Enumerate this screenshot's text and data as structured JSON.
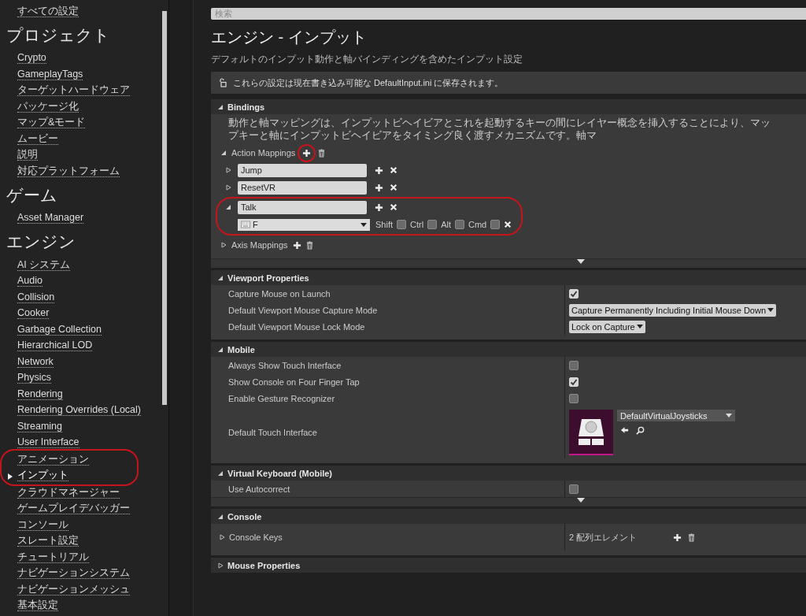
{
  "sidebar": {
    "all_settings": "すべての設定",
    "groups": [
      {
        "title": "プロジェクト",
        "items": [
          {
            "label": "Crypto",
            "selected": false
          },
          {
            "label": "GameplayTags",
            "selected": false
          },
          {
            "label": "ターゲットハードウェア",
            "selected": false
          },
          {
            "label": "パッケージ化",
            "selected": false
          },
          {
            "label": "マップ&モード",
            "selected": false
          },
          {
            "label": "ムービー",
            "selected": false
          },
          {
            "label": "説明",
            "selected": false
          },
          {
            "label": "対応プラットフォーム",
            "selected": false
          }
        ]
      },
      {
        "title": "ゲーム",
        "items": [
          {
            "label": "Asset Manager",
            "selected": false
          }
        ]
      },
      {
        "title": "エンジン",
        "items": [
          {
            "label": "AI システム",
            "selected": false
          },
          {
            "label": "Audio",
            "selected": false
          },
          {
            "label": "Collision",
            "selected": false
          },
          {
            "label": "Cooker",
            "selected": false
          },
          {
            "label": "Garbage Collection",
            "selected": false
          },
          {
            "label": "Hierarchical LOD",
            "selected": false
          },
          {
            "label": "Network",
            "selected": false
          },
          {
            "label": "Physics",
            "selected": false
          },
          {
            "label": "Rendering",
            "selected": false
          },
          {
            "label": "Rendering Overrides (Local)",
            "selected": false
          },
          {
            "label": "Streaming",
            "selected": false
          },
          {
            "label": "User Interface",
            "selected": false
          },
          {
            "label": "アニメーション",
            "selected": false
          },
          {
            "label": "インプット",
            "selected": true
          },
          {
            "label": "クラウドマネージャー",
            "selected": false
          },
          {
            "label": "ゲームプレイデバッガー",
            "selected": false
          },
          {
            "label": "コンソール",
            "selected": false
          },
          {
            "label": "スレート設定",
            "selected": false
          },
          {
            "label": "チュートリアル",
            "selected": false
          },
          {
            "label": "ナビゲーションシステム",
            "selected": false
          },
          {
            "label": "ナビゲーションメッシュ",
            "selected": false
          },
          {
            "label": "基本設定",
            "selected": false
          }
        ]
      }
    ]
  },
  "search": {
    "placeholder": "検索"
  },
  "title": "エンジン - インプット",
  "description": "デフォルトのインプット動作と軸バインディングを含めたインプット設定",
  "notice": "これらの設定は現在書き込み可能な DefaultInput.ini に保存されます。",
  "sections": [
    {
      "kind": "bindings",
      "title": "Bindings",
      "expanded": true,
      "show_more": true,
      "description": "動作と軸マッピングは、インプットビヘイビアとこれを起動するキーの間にレイヤー概念を挿入することにより、マップキーと軸にインプットビヘイビアをタイミング良く渡すメカニズムです。軸マ",
      "action_mappings": {
        "label": "Action Mappings",
        "expanded": true,
        "mappings": [
          {
            "name": "Jump",
            "expanded": false
          },
          {
            "name": "ResetVR",
            "expanded": false
          },
          {
            "name": "Talk",
            "expanded": true,
            "key": "F",
            "modifiers": [
              {
                "label": "Shift",
                "checked": false
              },
              {
                "label": "Ctrl",
                "checked": false
              },
              {
                "label": "Alt",
                "checked": false
              },
              {
                "label": "Cmd",
                "checked": false
              }
            ]
          }
        ]
      },
      "axis_mappings": {
        "label": "Axis Mappings",
        "expanded": false
      }
    },
    {
      "kind": "properties",
      "title": "Viewport Properties",
      "expanded": true,
      "show_more": false,
      "rows": [
        {
          "kind": "checkbox",
          "label": "Capture Mouse on Launch",
          "checked": true
        },
        {
          "kind": "dropdown",
          "label": "Default Viewport Mouse Capture Mode",
          "value": "Capture Permanently Including Initial Mouse Down"
        },
        {
          "kind": "dropdown",
          "label": "Default Viewport Mouse Lock Mode",
          "value": "Lock on Capture"
        }
      ]
    },
    {
      "kind": "properties",
      "title": "Mobile",
      "expanded": true,
      "show_more": false,
      "rows": [
        {
          "kind": "checkbox",
          "label": "Always Show Touch Interface",
          "checked": false
        },
        {
          "kind": "checkbox",
          "label": "Show Console on Four Finger Tap",
          "checked": true
        },
        {
          "kind": "checkbox",
          "label": "Enable Gesture Recognizer",
          "checked": false
        },
        {
          "kind": "asset",
          "label": "Default Touch Interface",
          "value": "DefaultVirtualJoysticks"
        }
      ]
    },
    {
      "kind": "properties",
      "title": "Virtual Keyboard (Mobile)",
      "expanded": true,
      "show_more": true,
      "rows": [
        {
          "kind": "checkbox",
          "label": "Use Autocorrect",
          "checked": false
        }
      ]
    },
    {
      "kind": "properties",
      "title": "Console",
      "expanded": true,
      "show_more": false,
      "rows": [
        {
          "kind": "array",
          "label": "Console Keys",
          "expanded": false,
          "value": "2 配列エレメント"
        }
      ]
    },
    {
      "title": "Mouse Properties",
      "expanded": false
    }
  ]
}
